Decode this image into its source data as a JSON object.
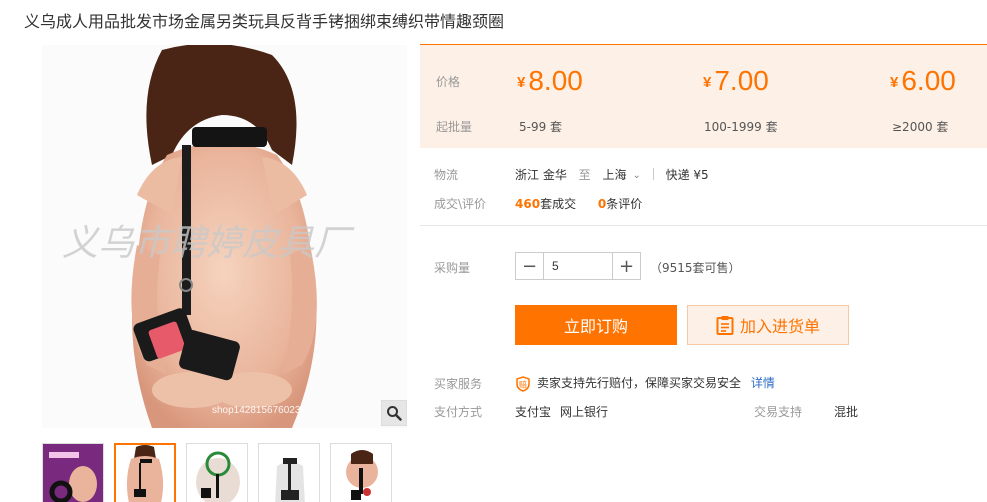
{
  "title": "义乌成人用品批发市场金属另类玩具反背手铐捆绑束缚织带情趣颈圈",
  "image": {
    "watermark": "义乌市聘婷皮具厂",
    "watermark_sub": "shop1428156760232",
    "zoom_icon": "magnifier-icon"
  },
  "price_box": {
    "price_label": "价格",
    "batch_label": "起批量",
    "currency": "¥",
    "tiers": [
      {
        "price": "8.00",
        "qty": "5-99 套"
      },
      {
        "price": "7.00",
        "qty": "100-1999 套"
      },
      {
        "price": "6.00",
        "qty": "≥2000 套"
      }
    ]
  },
  "logistics": {
    "label": "物流",
    "from": "浙江 金华",
    "to_word": "至",
    "to": "上海",
    "express": "快递 ¥5"
  },
  "deals": {
    "label": "成交\\评价",
    "deal_count": "460",
    "deal_suffix": "套成交",
    "review_count": "0",
    "review_suffix": "条评价"
  },
  "purchase": {
    "label": "采购量",
    "value": "5",
    "available": "（9515套可售）"
  },
  "buttons": {
    "buy": "立即订购",
    "cart": "加入进货单"
  },
  "service": {
    "label": "买家服务",
    "text": "卖家支持先行赔付，保障买家交易安全",
    "link": "详情"
  },
  "payment": {
    "label": "支付方式",
    "methods": [
      "支付宝",
      "网上银行"
    ],
    "trade_label": "交易支持",
    "trade_value": "混批"
  },
  "colors": {
    "accent": "#ff7300",
    "price_bg": "#fdf0e6",
    "link": "#2b6cc4"
  }
}
